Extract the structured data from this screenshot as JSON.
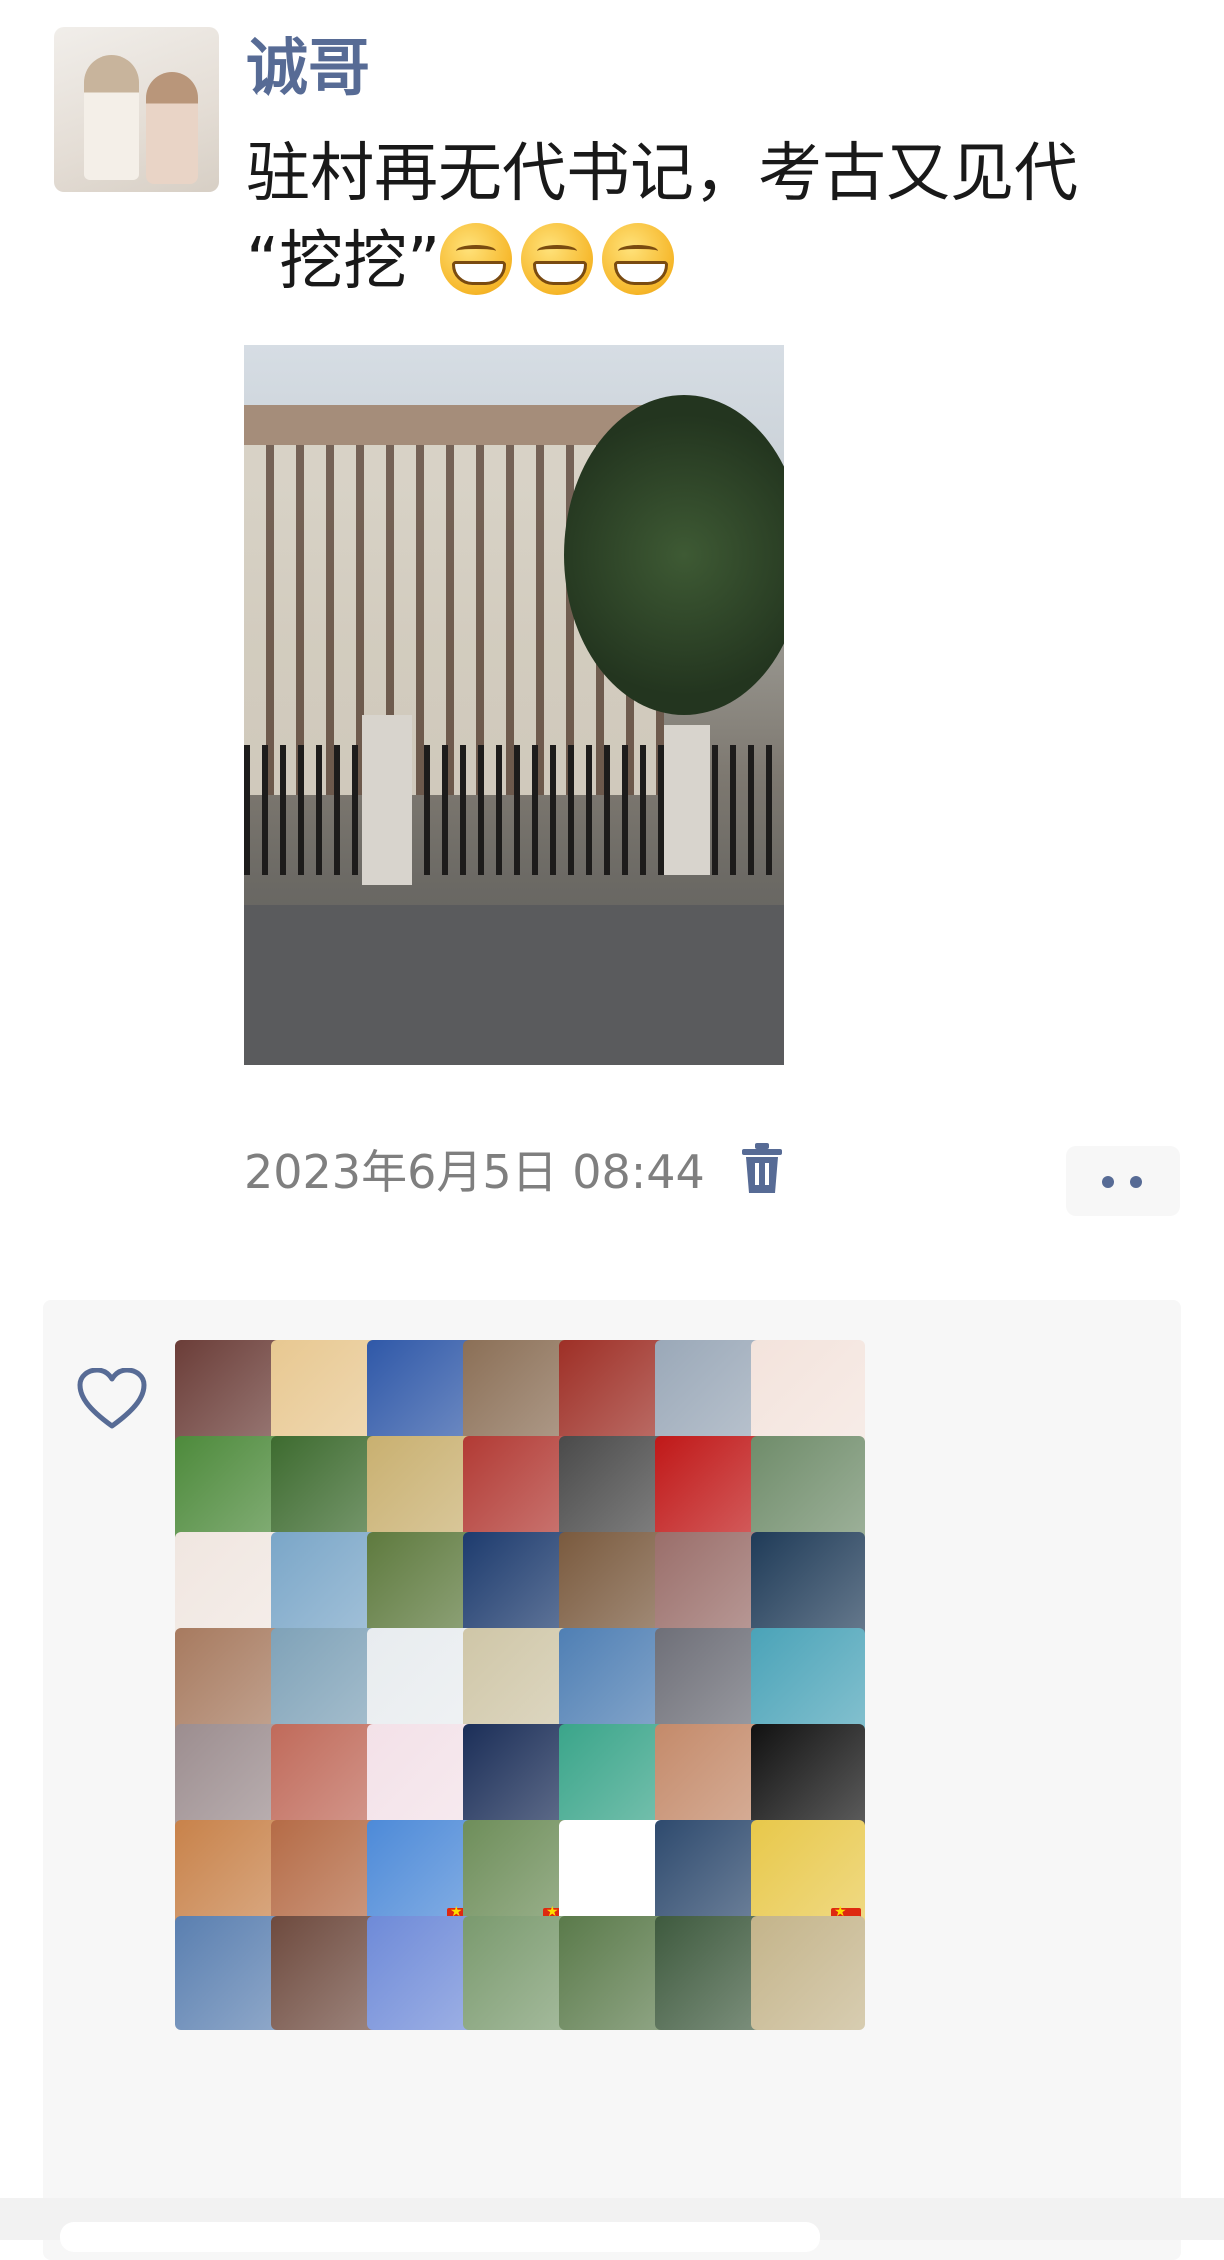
{
  "post": {
    "username": "诚哥",
    "text_line1": "驻村再无代书记，考古又见代",
    "text_line2": "“挖挖”",
    "emoji_icon": "grinning-face-emoji",
    "emoji_count": 3,
    "timestamp": "2023年6月5日 08:44"
  },
  "icons": {
    "delete": "trash-icon",
    "more": "more-dots-icon",
    "like": "heart-outline-icon"
  },
  "colors": {
    "link": "#576b95",
    "panel": "#f7f7f7"
  },
  "likers": [
    [
      "#6b3d38",
      "#e8c891",
      "#2f58a8",
      "#8b6f56",
      "#9e2f26",
      "#9aa8b8",
      "#f3e3dc"
    ],
    [
      "#4d8a3b",
      "#3d6b2f",
      "#c9b070",
      "#b23a34",
      "#4a4a4a",
      "#c01818",
      "#6f8c6a"
    ],
    [
      "#f0e6e0",
      "#7aa6c8",
      "#5e7a3e",
      "#1d3b6e",
      "#7a5a3e",
      "#9a6e6a",
      "#1f3b58"
    ],
    [
      "#a77a5f",
      "#7fa2b8",
      "#e8ecef",
      "#cfc6a7",
      "#4f7fb4",
      "#6e6f78",
      "#4aa3b8"
    ],
    [
      "#9c8d8f",
      "#c06a5a",
      "#f3e1e8",
      "#1b2e58",
      "#3aa58a",
      "#c48a6a",
      "#111111"
    ],
    [
      "#c8824a",
      "#b56b46",
      "#4d8ad8",
      "#6e8e5a",
      "#ffffff",
      "#2e4a6e",
      "#e8c84a"
    ],
    [
      "#5a7fb0",
      "#6e4a3e",
      "#6e8ad8",
      "#7a9a6e",
      "#5a7a4a",
      "#3e5a3e",
      "#c4b48a"
    ]
  ],
  "flags": [
    [
      5,
      2
    ],
    [
      5,
      3
    ],
    [
      5,
      6
    ]
  ]
}
